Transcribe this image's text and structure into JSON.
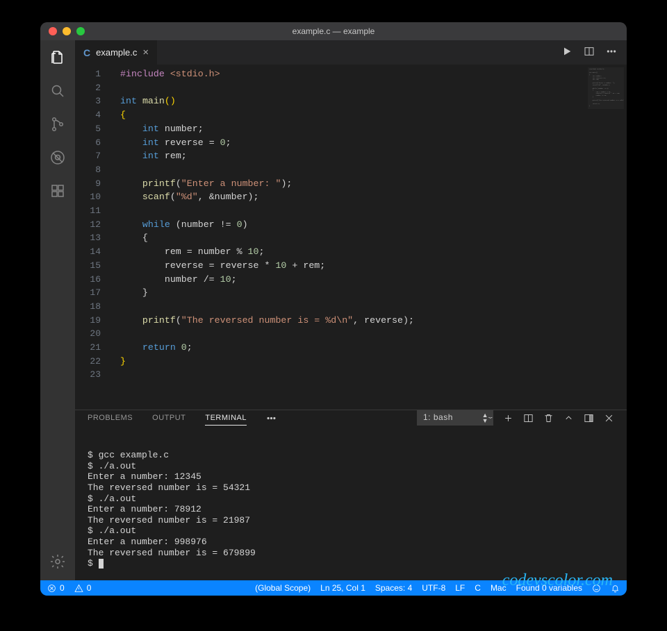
{
  "window": {
    "title": "example.c — example"
  },
  "tab": {
    "lang_badge": "C",
    "filename": "example.c"
  },
  "code": {
    "lines": [
      {
        "n": 1,
        "segs": [
          [
            "pp",
            "#include"
          ],
          [
            "pn",
            " "
          ],
          [
            "st",
            "<stdio.h>"
          ]
        ]
      },
      {
        "n": 2,
        "segs": [
          [
            "pn",
            ""
          ]
        ]
      },
      {
        "n": 3,
        "segs": [
          [
            "ty",
            "int"
          ],
          [
            "pn",
            " "
          ],
          [
            "fn",
            "main"
          ],
          [
            "br",
            "()"
          ]
        ]
      },
      {
        "n": 4,
        "segs": [
          [
            "br",
            "{"
          ]
        ]
      },
      {
        "n": 5,
        "segs": [
          [
            "pn",
            "    "
          ],
          [
            "ty",
            "int"
          ],
          [
            "pn",
            " number;"
          ]
        ]
      },
      {
        "n": 6,
        "segs": [
          [
            "pn",
            "    "
          ],
          [
            "ty",
            "int"
          ],
          [
            "pn",
            " reverse = "
          ],
          [
            "nu",
            "0"
          ],
          [
            "pn",
            ";"
          ]
        ]
      },
      {
        "n": 7,
        "segs": [
          [
            "pn",
            "    "
          ],
          [
            "ty",
            "int"
          ],
          [
            "pn",
            " rem;"
          ]
        ]
      },
      {
        "n": 8,
        "segs": [
          [
            "pn",
            ""
          ]
        ]
      },
      {
        "n": 9,
        "segs": [
          [
            "pn",
            "    "
          ],
          [
            "fn",
            "printf"
          ],
          [
            "pn",
            "("
          ],
          [
            "st",
            "\"Enter a number: \""
          ],
          [
            "pn",
            ");"
          ]
        ]
      },
      {
        "n": 10,
        "segs": [
          [
            "pn",
            "    "
          ],
          [
            "fn",
            "scanf"
          ],
          [
            "pn",
            "("
          ],
          [
            "st",
            "\"%d\""
          ],
          [
            "pn",
            ", &number);"
          ]
        ]
      },
      {
        "n": 11,
        "segs": [
          [
            "pn",
            ""
          ]
        ]
      },
      {
        "n": 12,
        "segs": [
          [
            "pn",
            "    "
          ],
          [
            "kw",
            "while"
          ],
          [
            "pn",
            " (number != "
          ],
          [
            "nu",
            "0"
          ],
          [
            "pn",
            ")"
          ]
        ]
      },
      {
        "n": 13,
        "segs": [
          [
            "pn",
            "    {"
          ]
        ]
      },
      {
        "n": 14,
        "segs": [
          [
            "pn",
            "        rem = number % "
          ],
          [
            "nu",
            "10"
          ],
          [
            "pn",
            ";"
          ]
        ]
      },
      {
        "n": 15,
        "segs": [
          [
            "pn",
            "        reverse = reverse * "
          ],
          [
            "nu",
            "10"
          ],
          [
            "pn",
            " + rem;"
          ]
        ]
      },
      {
        "n": 16,
        "segs": [
          [
            "pn",
            "        number /= "
          ],
          [
            "nu",
            "10"
          ],
          [
            "pn",
            ";"
          ]
        ]
      },
      {
        "n": 17,
        "segs": [
          [
            "pn",
            "    }"
          ]
        ]
      },
      {
        "n": 18,
        "segs": [
          [
            "pn",
            ""
          ]
        ]
      },
      {
        "n": 19,
        "segs": [
          [
            "pn",
            "    "
          ],
          [
            "fn",
            "printf"
          ],
          [
            "pn",
            "("
          ],
          [
            "st",
            "\"The reversed number is = %d\\n\""
          ],
          [
            "pn",
            ", reverse);"
          ]
        ]
      },
      {
        "n": 20,
        "segs": [
          [
            "pn",
            ""
          ]
        ]
      },
      {
        "n": 21,
        "segs": [
          [
            "pn",
            "    "
          ],
          [
            "kw",
            "return"
          ],
          [
            "pn",
            " "
          ],
          [
            "nu",
            "0"
          ],
          [
            "pn",
            ";"
          ]
        ]
      },
      {
        "n": 22,
        "segs": [
          [
            "br",
            "}"
          ]
        ]
      },
      {
        "n": 23,
        "segs": [
          [
            "pn",
            ""
          ]
        ]
      }
    ]
  },
  "panel": {
    "tabs": {
      "problems": "PROBLEMS",
      "output": "OUTPUT",
      "terminal": "TERMINAL"
    },
    "terminal_selector": "1: bash",
    "terminal_lines": [
      "$ gcc example.c",
      "$ ./a.out",
      "Enter a number: 12345",
      "The reversed number is = 54321",
      "$ ./a.out",
      "Enter a number: 78912",
      "The reversed number is = 21987",
      "$ ./a.out",
      "Enter a number: 998976",
      "The reversed number is = 679899",
      "$ "
    ],
    "watermark": "codevscolor.com"
  },
  "status": {
    "errors": "0",
    "warnings": "0",
    "scope": "(Global Scope)",
    "position": "Ln 25, Col 1",
    "spaces": "Spaces: 4",
    "encoding": "UTF-8",
    "eol": "LF",
    "language": "C",
    "os": "Mac",
    "found": "Found 0 variables"
  }
}
